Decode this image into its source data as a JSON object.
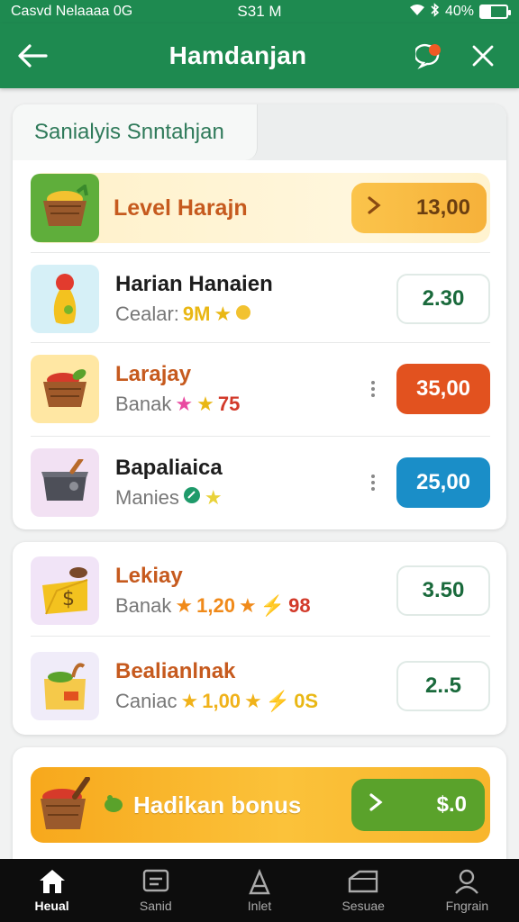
{
  "status_bar": {
    "carrier": "Casvd Nelaaaa 0G",
    "time": "S31 M",
    "battery": "40%"
  },
  "app_bar": {
    "title": "Hamdanjan"
  },
  "section": {
    "tab_label": "Sanialyis Snntahjan"
  },
  "featured": {
    "title": "Level Harajn",
    "price": "13,00"
  },
  "list_rows": [
    {
      "title": "Harian Hanaien",
      "sub_label": "Cealar:",
      "sub_value": "9M",
      "price": "2.30",
      "thumb_color": "#d6f0f7"
    },
    {
      "title": "Larajay",
      "sub_label": "Banak",
      "sub_value": "75",
      "price": "35,00",
      "thumb_color": "#ffe7a3"
    },
    {
      "title": "Bapaliaica",
      "sub_label": "Manies",
      "sub_value": "",
      "price": "25,00",
      "thumb_color": "#f2e1f3"
    }
  ],
  "list_rows_2": [
    {
      "title": "Lekiay",
      "sub_label": "Banak",
      "sub_value": "1,20",
      "sub_extra": "98",
      "price": "3.50",
      "thumb_color": "#f1e4f7"
    },
    {
      "title": "Bealianlnak",
      "sub_label": "Caniac",
      "sub_value": "1,00",
      "sub_extra": "0S",
      "price": "2..5",
      "thumb_color": "#f0ecf9"
    }
  ],
  "bonus": {
    "label": "Hadikan bonus",
    "value": "$.0"
  },
  "bottom_nav": [
    {
      "label": "Heual"
    },
    {
      "label": "Sanid"
    },
    {
      "label": "Inlet"
    },
    {
      "label": "Sesuae"
    },
    {
      "label": "Fngrain"
    }
  ],
  "colors": {
    "brand_green": "#1e8a50",
    "orange": "#e2521f",
    "blue": "#1a8ec8",
    "gold": "#f6b13a"
  }
}
